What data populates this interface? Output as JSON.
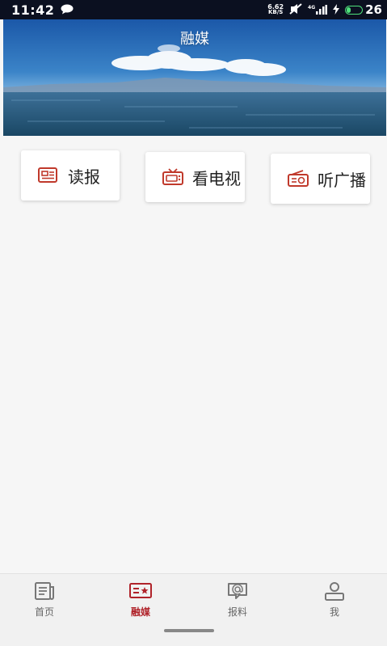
{
  "status_bar": {
    "time": "11:42",
    "net_speed_value": "6.62",
    "net_speed_unit": "KB/S",
    "network_type": "4G",
    "battery_level": "26",
    "icons": [
      "chat-bubble-icon",
      "mute-icon",
      "signal-icon",
      "charging-icon",
      "battery-icon"
    ]
  },
  "header": {
    "title": "融媒"
  },
  "entries": [
    {
      "label": "读报",
      "icon": "newspaper-icon"
    },
    {
      "label": "看电视",
      "icon": "tv-icon"
    },
    {
      "label": "听广播",
      "icon": "radio-icon"
    }
  ],
  "bottom_nav": {
    "items": [
      {
        "label": "首页",
        "icon": "news-icon",
        "active": false
      },
      {
        "label": "融媒",
        "icon": "media-star-icon",
        "active": true
      },
      {
        "label": "报料",
        "icon": "report-chat-icon",
        "active": false
      },
      {
        "label": "我",
        "icon": "user-icon",
        "active": false
      }
    ]
  },
  "colors": {
    "accent": "#b0232a",
    "icon_red": "#c0392b",
    "inactive": "#666666",
    "background": "#f6f6f6"
  }
}
